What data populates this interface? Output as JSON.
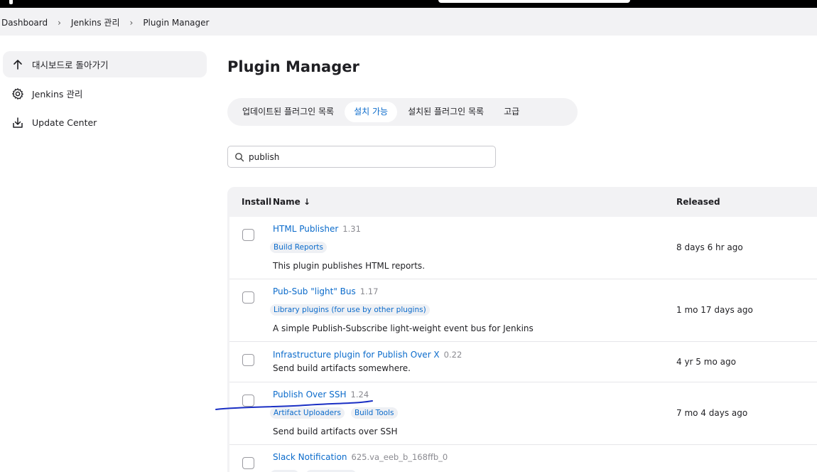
{
  "breadcrumb": [
    "Dashboard",
    "Jenkins 관리",
    "Plugin Manager"
  ],
  "sidebar": {
    "items": [
      {
        "label": "대시보드로 돌아가기",
        "icon": "arrow-up-icon"
      },
      {
        "label": "Jenkins 관리",
        "icon": "gear-icon"
      },
      {
        "label": "Update Center",
        "icon": "download-icon"
      }
    ]
  },
  "page_title": "Plugin Manager",
  "tabs": [
    {
      "label": "업데이트된 플러그인 목록",
      "active": false
    },
    {
      "label": "설치 가능",
      "active": true
    },
    {
      "label": "설치된 플러그인 목록",
      "active": false
    },
    {
      "label": "고급",
      "active": false
    }
  ],
  "search": {
    "value": "publish",
    "icon": "search-icon"
  },
  "table": {
    "headers": {
      "install": "Install",
      "name": "Name",
      "sort_indicator": "↓",
      "released": "Released"
    },
    "rows": [
      {
        "name": "HTML Publisher",
        "version": "1.31",
        "tags": [
          "Build Reports"
        ],
        "description": "This plugin publishes HTML reports.",
        "released": "8 days 6 hr ago"
      },
      {
        "name": "Pub-Sub \"light\" Bus",
        "version": "1.17",
        "tags": [
          "Library plugins (for use by other plugins)"
        ],
        "description": "A simple Publish-Subscribe light-weight event bus for Jenkins",
        "released": "1 mo 17 days ago"
      },
      {
        "name": "Infrastructure plugin for Publish Over X",
        "version": "0.22",
        "tags": [],
        "description": "Send build artifacts somewhere.",
        "released": "4 yr 5 mo ago"
      },
      {
        "name": "Publish Over SSH",
        "version": "1.24",
        "tags": [
          "Artifact Uploaders",
          "Build Tools"
        ],
        "description": "Send build artifacts over SSH",
        "released": "7 mo 4 days ago"
      },
      {
        "name": "Slack Notification",
        "version": "625.va_eeb_b_168ffb_0",
        "tags": [],
        "description": "",
        "released": ""
      }
    ]
  },
  "colors": {
    "link": "#0b6bcb",
    "annotation": "#1a2fc4",
    "panel": "#f2f2f4"
  }
}
